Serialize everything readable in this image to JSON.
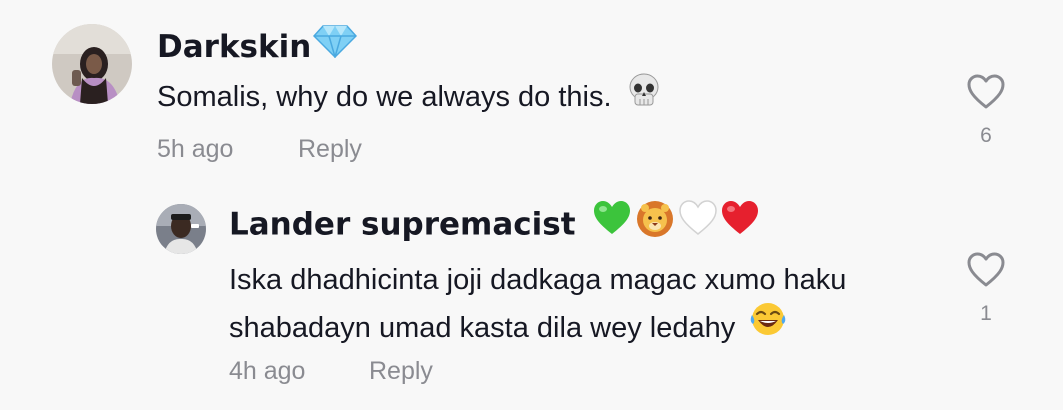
{
  "comments": [
    {
      "username": "Darkskin",
      "username_badge": "gem-icon",
      "text": "Somalis, why do we always do this.",
      "text_emoji": "skull-icon",
      "time": "5h ago",
      "reply_label": "Reply",
      "likes": "6"
    },
    {
      "username": "Lander supremacist",
      "username_badges": [
        "green-heart-icon",
        "lion-icon",
        "white-heart-icon",
        "red-heart-icon"
      ],
      "text_line1": "Iska dhadhicinta joji dadkaga magac xumo haku",
      "text_line2": "shabadayn umad kasta dila wey ledahy",
      "text_emoji": "laughing-tears-icon",
      "time": "4h ago",
      "reply_label": "Reply",
      "likes": "1"
    }
  ],
  "colors": {
    "background": "#f8f8f8",
    "primary_text": "#161823",
    "secondary_text": "#8a8b91",
    "heart_outline": "#8a8b91"
  }
}
